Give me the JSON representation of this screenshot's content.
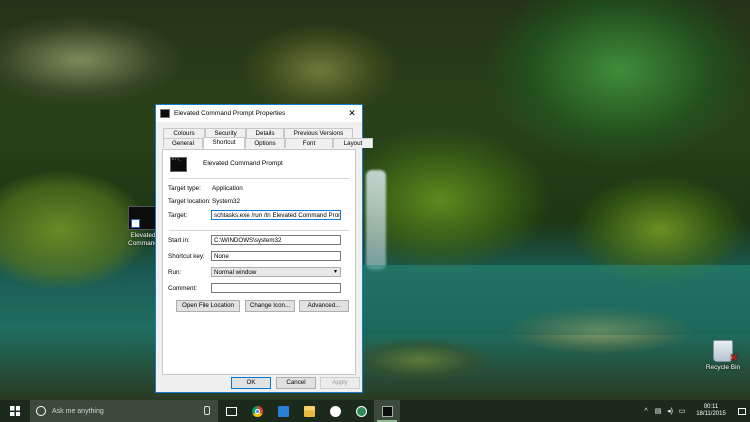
{
  "desktop": {
    "icons": [
      {
        "label_line1": "Elevated",
        "label_line2": "Command",
        "icon": "cmd-shortcut-icon"
      },
      {
        "label": "Recycle Bin",
        "icon": "recycle-bin-icon"
      }
    ]
  },
  "window": {
    "title": "Elevated Command Prompt Properties",
    "close_glyph": "✕",
    "tabs_top": [
      "Colours",
      "Security",
      "Details",
      "Previous Versions"
    ],
    "tabs_bottom": [
      "General",
      "Shortcut",
      "Options",
      "Font",
      "Layout"
    ],
    "active_tab": "Shortcut",
    "shortcut_name": "Elevated Command Prompt",
    "target_type_label": "Target type:",
    "target_type_value": "Application",
    "target_location_label": "Target location:",
    "target_location_value": "System32",
    "target_label": "Target:",
    "target_value": "schtasks.exe /run /tn Elevated Command Prompt",
    "start_in_label": "Start in:",
    "start_in_value": "C:\\WINDOWS\\system32",
    "shortcut_key_label": "Shortcut key:",
    "shortcut_key_value": "None",
    "run_label": "Run:",
    "run_value": "Normal window",
    "comment_label": "Comment:",
    "comment_value": "",
    "buttons": {
      "open_file_location": "Open File Location",
      "change_icon": "Change Icon...",
      "advanced": "Advanced...",
      "ok": "OK",
      "cancel": "Cancel",
      "apply": "Apply"
    }
  },
  "taskbar": {
    "search_placeholder": "Ask me anything",
    "time": "00:11",
    "date": "18/11/2015",
    "tray_chevron": "^"
  }
}
